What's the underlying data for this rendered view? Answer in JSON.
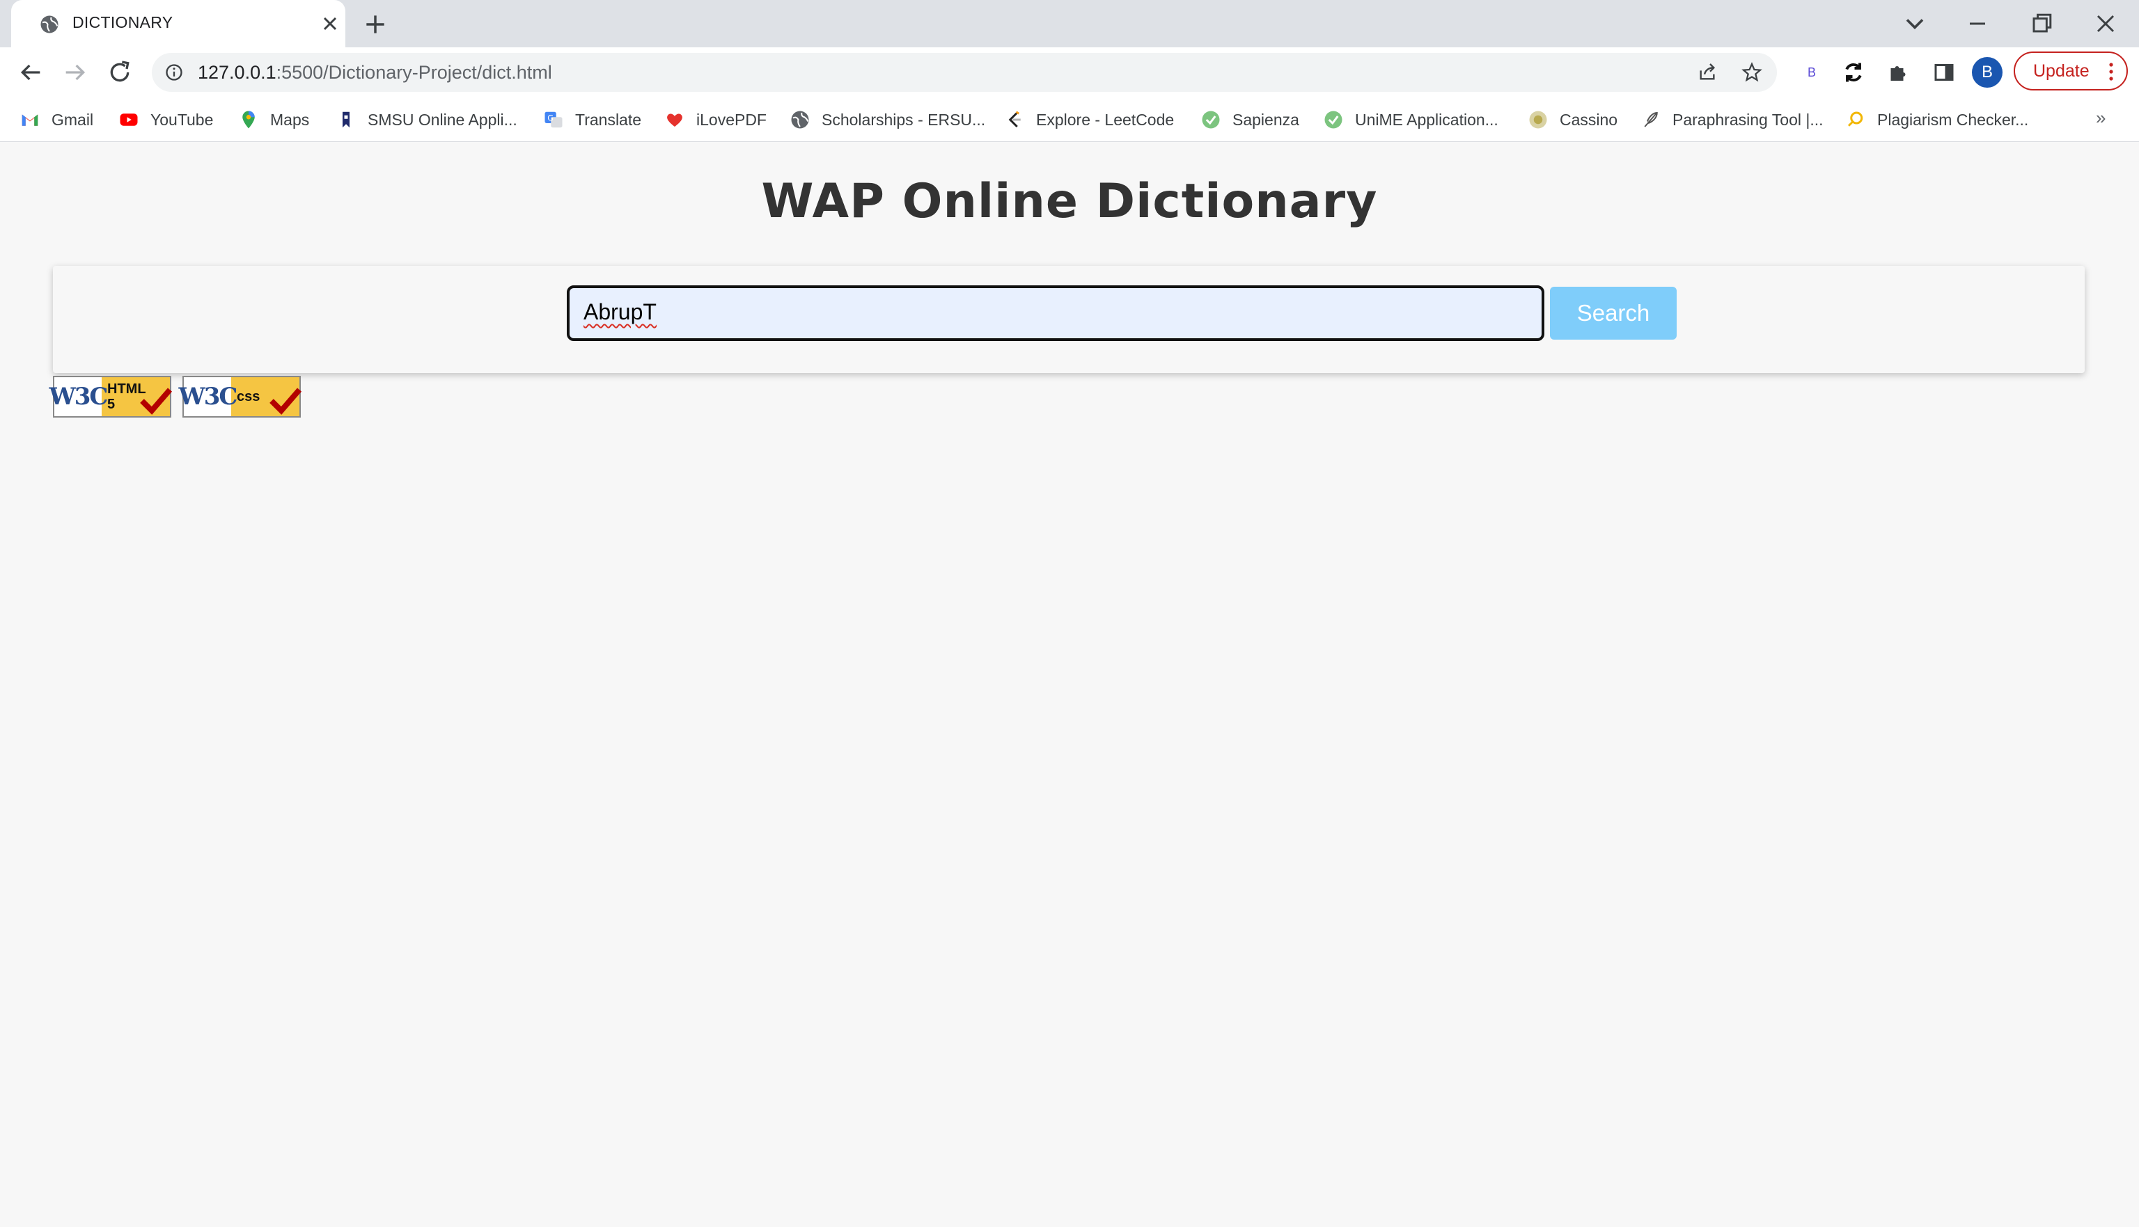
{
  "browser": {
    "tab": {
      "title": "DICTIONARY"
    },
    "address_bar": {
      "url_host": "127.0.0.1",
      "url_path": ":5500/Dictionary-Project/dict.html"
    },
    "profile_initial": "B",
    "extension_badge": "B",
    "update_label": "Update",
    "bookmarks": [
      {
        "label": "Gmail",
        "icon": "gmail-icon"
      },
      {
        "label": "YouTube",
        "icon": "youtube-icon"
      },
      {
        "label": "Maps",
        "icon": "maps-icon"
      },
      {
        "label": "SMSU Online Appli...",
        "icon": "bookmark-icon"
      },
      {
        "label": "Translate",
        "icon": "translate-icon"
      },
      {
        "label": "iLovePDF",
        "icon": "heart-icon"
      },
      {
        "label": "Scholarships - ERSU...",
        "icon": "globe-icon"
      },
      {
        "label": "Explore - LeetCode",
        "icon": "leetcode-icon"
      },
      {
        "label": "Sapienza",
        "icon": "check-circle-icon"
      },
      {
        "label": "UniME Application...",
        "icon": "check-circle-icon"
      },
      {
        "label": "Cassino",
        "icon": "seal-icon"
      },
      {
        "label": "Paraphrasing Tool |...",
        "icon": "feather-icon"
      },
      {
        "label": "Plagiarism Checker...",
        "icon": "search-icon"
      }
    ],
    "more_bookmarks": "»"
  },
  "page": {
    "title": "WAP Online Dictionary",
    "search": {
      "value": "AbrupT",
      "button_label": "Search"
    },
    "badges": [
      {
        "brand": "W3C",
        "label_line1": "HTML",
        "label_line2": "5"
      },
      {
        "brand": "W3C",
        "label_line1": "css",
        "label_line2": ""
      }
    ]
  },
  "colors": {
    "search_button": "#7fcdfa",
    "input_bg": "#e8f0fe",
    "update_red": "#c5221f",
    "page_bg": "#f7f7f7"
  }
}
